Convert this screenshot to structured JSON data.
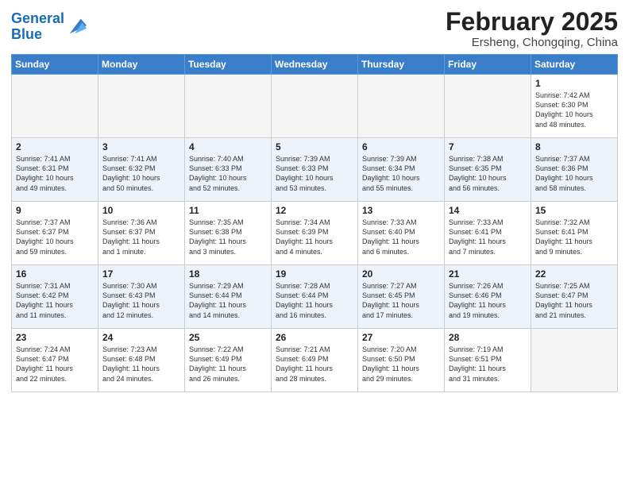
{
  "logo": {
    "line1": "General",
    "line2": "Blue"
  },
  "title": "February 2025",
  "location": "Ersheng, Chongqing, China",
  "days_of_week": [
    "Sunday",
    "Monday",
    "Tuesday",
    "Wednesday",
    "Thursday",
    "Friday",
    "Saturday"
  ],
  "weeks": [
    [
      {
        "day": "",
        "info": ""
      },
      {
        "day": "",
        "info": ""
      },
      {
        "day": "",
        "info": ""
      },
      {
        "day": "",
        "info": ""
      },
      {
        "day": "",
        "info": ""
      },
      {
        "day": "",
        "info": ""
      },
      {
        "day": "1",
        "info": "Sunrise: 7:42 AM\nSunset: 6:30 PM\nDaylight: 10 hours\nand 48 minutes."
      }
    ],
    [
      {
        "day": "2",
        "info": "Sunrise: 7:41 AM\nSunset: 6:31 PM\nDaylight: 10 hours\nand 49 minutes."
      },
      {
        "day": "3",
        "info": "Sunrise: 7:41 AM\nSunset: 6:32 PM\nDaylight: 10 hours\nand 50 minutes."
      },
      {
        "day": "4",
        "info": "Sunrise: 7:40 AM\nSunset: 6:33 PM\nDaylight: 10 hours\nand 52 minutes."
      },
      {
        "day": "5",
        "info": "Sunrise: 7:39 AM\nSunset: 6:33 PM\nDaylight: 10 hours\nand 53 minutes."
      },
      {
        "day": "6",
        "info": "Sunrise: 7:39 AM\nSunset: 6:34 PM\nDaylight: 10 hours\nand 55 minutes."
      },
      {
        "day": "7",
        "info": "Sunrise: 7:38 AM\nSunset: 6:35 PM\nDaylight: 10 hours\nand 56 minutes."
      },
      {
        "day": "8",
        "info": "Sunrise: 7:37 AM\nSunset: 6:36 PM\nDaylight: 10 hours\nand 58 minutes."
      }
    ],
    [
      {
        "day": "9",
        "info": "Sunrise: 7:37 AM\nSunset: 6:37 PM\nDaylight: 10 hours\nand 59 minutes."
      },
      {
        "day": "10",
        "info": "Sunrise: 7:36 AM\nSunset: 6:37 PM\nDaylight: 11 hours\nand 1 minute."
      },
      {
        "day": "11",
        "info": "Sunrise: 7:35 AM\nSunset: 6:38 PM\nDaylight: 11 hours\nand 3 minutes."
      },
      {
        "day": "12",
        "info": "Sunrise: 7:34 AM\nSunset: 6:39 PM\nDaylight: 11 hours\nand 4 minutes."
      },
      {
        "day": "13",
        "info": "Sunrise: 7:33 AM\nSunset: 6:40 PM\nDaylight: 11 hours\nand 6 minutes."
      },
      {
        "day": "14",
        "info": "Sunrise: 7:33 AM\nSunset: 6:41 PM\nDaylight: 11 hours\nand 7 minutes."
      },
      {
        "day": "15",
        "info": "Sunrise: 7:32 AM\nSunset: 6:41 PM\nDaylight: 11 hours\nand 9 minutes."
      }
    ],
    [
      {
        "day": "16",
        "info": "Sunrise: 7:31 AM\nSunset: 6:42 PM\nDaylight: 11 hours\nand 11 minutes."
      },
      {
        "day": "17",
        "info": "Sunrise: 7:30 AM\nSunset: 6:43 PM\nDaylight: 11 hours\nand 12 minutes."
      },
      {
        "day": "18",
        "info": "Sunrise: 7:29 AM\nSunset: 6:44 PM\nDaylight: 11 hours\nand 14 minutes."
      },
      {
        "day": "19",
        "info": "Sunrise: 7:28 AM\nSunset: 6:44 PM\nDaylight: 11 hours\nand 16 minutes."
      },
      {
        "day": "20",
        "info": "Sunrise: 7:27 AM\nSunset: 6:45 PM\nDaylight: 11 hours\nand 17 minutes."
      },
      {
        "day": "21",
        "info": "Sunrise: 7:26 AM\nSunset: 6:46 PM\nDaylight: 11 hours\nand 19 minutes."
      },
      {
        "day": "22",
        "info": "Sunrise: 7:25 AM\nSunset: 6:47 PM\nDaylight: 11 hours\nand 21 minutes."
      }
    ],
    [
      {
        "day": "23",
        "info": "Sunrise: 7:24 AM\nSunset: 6:47 PM\nDaylight: 11 hours\nand 22 minutes."
      },
      {
        "day": "24",
        "info": "Sunrise: 7:23 AM\nSunset: 6:48 PM\nDaylight: 11 hours\nand 24 minutes."
      },
      {
        "day": "25",
        "info": "Sunrise: 7:22 AM\nSunset: 6:49 PM\nDaylight: 11 hours\nand 26 minutes."
      },
      {
        "day": "26",
        "info": "Sunrise: 7:21 AM\nSunset: 6:49 PM\nDaylight: 11 hours\nand 28 minutes."
      },
      {
        "day": "27",
        "info": "Sunrise: 7:20 AM\nSunset: 6:50 PM\nDaylight: 11 hours\nand 29 minutes."
      },
      {
        "day": "28",
        "info": "Sunrise: 7:19 AM\nSunset: 6:51 PM\nDaylight: 11 hours\nand 31 minutes."
      },
      {
        "day": "",
        "info": ""
      }
    ]
  ]
}
